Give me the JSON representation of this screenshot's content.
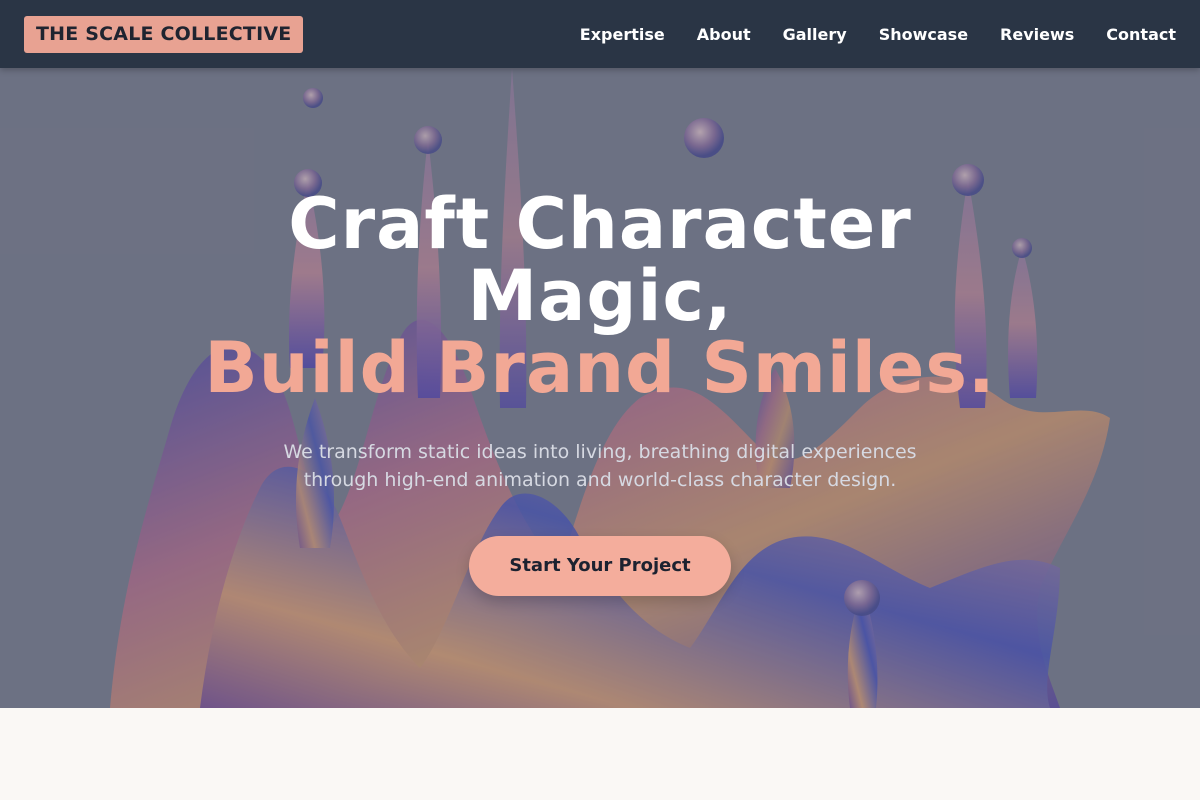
{
  "header": {
    "logo": "THE SCALE COLLECTIVE",
    "nav": [
      {
        "label": "Expertise"
      },
      {
        "label": "About"
      },
      {
        "label": "Gallery"
      },
      {
        "label": "Showcase"
      },
      {
        "label": "Reviews"
      },
      {
        "label": "Contact"
      }
    ]
  },
  "hero": {
    "headline_line1": "Craft Character",
    "headline_line2": "Magic,",
    "headline_accent": "Build Brand Smiles.",
    "subtext": "We transform static ideas into living, breathing digital experiences through high-end animation and world-class character design.",
    "cta_label": "Start Your Project"
  },
  "colors": {
    "nav_background": "#2a3545",
    "logo_background": "#e8a292",
    "accent": "#f2a895",
    "cta_background": "#f4ad9c",
    "page_background": "#faf8f5"
  },
  "icons": {
    "hero_image": "liquid-splash-art"
  }
}
